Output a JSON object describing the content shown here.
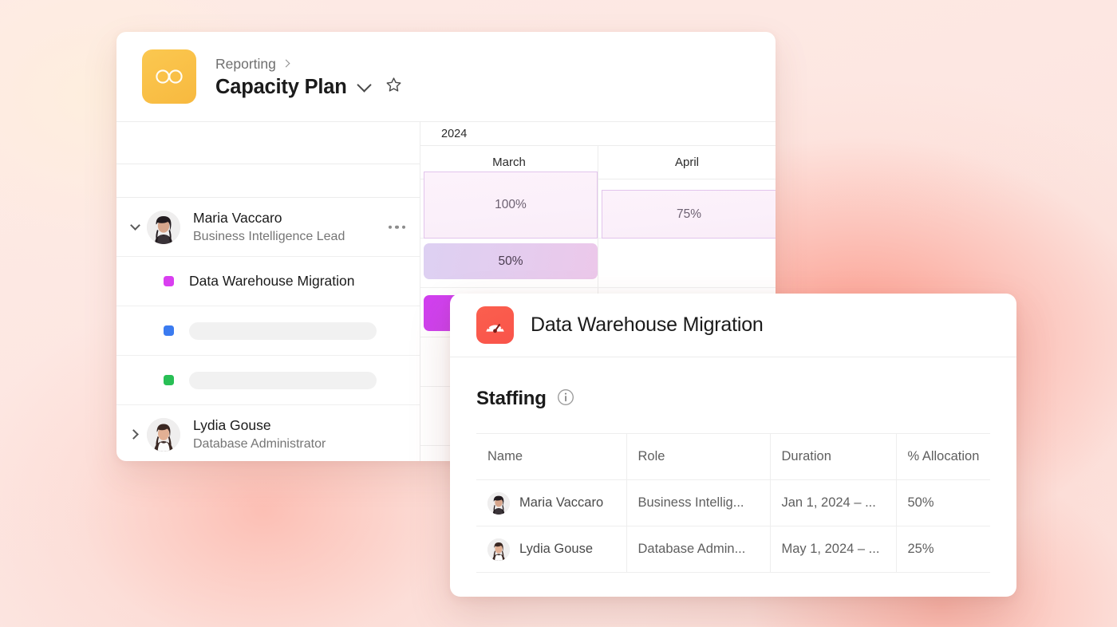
{
  "background": {
    "base_color": "#fce4df",
    "glow_color": "#fc9685"
  },
  "report_card": {
    "app_icon": "glasses-icon",
    "app_icon_color": "#fbc850",
    "breadcrumb": {
      "parent": "Reporting",
      "separator_icon": "chevron-right-icon"
    },
    "title": "Capacity Plan",
    "title_menu_icon": "chevron-down-icon",
    "favorite_icon": "star-icon",
    "timeline": {
      "year": "2024",
      "months": [
        "March",
        "April"
      ]
    },
    "rows": [
      {
        "type": "person",
        "expanded": true,
        "disclosure_icon": "chevron-down-icon",
        "avatar": "avatar-maria",
        "name": "Maria Vaccaro",
        "role": "Business Intelligence Lead",
        "menu_icon": "ellipsis-icon",
        "bars": [
          {
            "label": "100%",
            "month": "March",
            "style": "capacity"
          },
          {
            "label": "75%",
            "month": "April",
            "style": "capacity"
          }
        ]
      },
      {
        "type": "task",
        "swatch_color": "#d93ff0",
        "name": "Data Warehouse Migration",
        "bars": [
          {
            "label": "50%",
            "month": "March",
            "style": "allocation"
          }
        ]
      },
      {
        "type": "task-placeholder",
        "swatch_color": "#3b7bf0",
        "name": "",
        "bars": [
          {
            "label": "",
            "month": "March",
            "style": "plain"
          }
        ]
      },
      {
        "type": "task-placeholder",
        "swatch_color": "#28bf55",
        "name": "",
        "bars": []
      },
      {
        "type": "person",
        "expanded": false,
        "disclosure_icon": "chevron-right-icon",
        "avatar": "avatar-lydia",
        "name": "Lydia Gouse",
        "role": "Database Administrator",
        "bars": []
      }
    ]
  },
  "modal": {
    "icon": "gauge-icon",
    "icon_color": "#fb5f4e",
    "title": "Data Warehouse Migration",
    "section": {
      "title": "Staffing",
      "info_icon": "info-icon"
    },
    "table": {
      "columns": [
        "Name",
        "Role",
        "Duration",
        "% Allocation"
      ],
      "rows": [
        {
          "avatar": "avatar-maria",
          "name": "Maria Vaccaro",
          "role": "Business Intellig...",
          "duration": "Jan 1, 2024 – ...",
          "allocation": "50%"
        },
        {
          "avatar": "avatar-lydia",
          "name": "Lydia Gouse",
          "role": "Database Admin...",
          "duration": "May 1, 2024 – ...",
          "allocation": "25%"
        }
      ]
    }
  }
}
